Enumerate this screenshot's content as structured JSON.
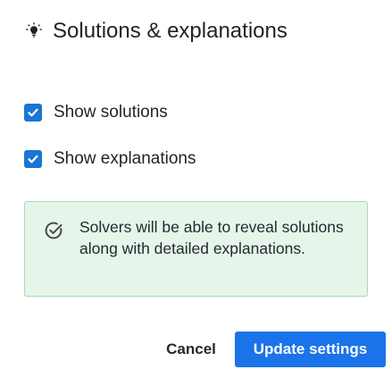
{
  "dialog": {
    "title": "Solutions & explanations",
    "title_icon": "lightbulb-icon"
  },
  "options": [
    {
      "label": "Show solutions",
      "checked": true
    },
    {
      "label": "Show explanations",
      "checked": true
    }
  ],
  "info": {
    "icon": "check-circle-icon",
    "text": "Solvers will be able to reveal solutions along with detailed explanations."
  },
  "actions": {
    "cancel_label": "Cancel",
    "update_label": "Update settings"
  },
  "colors": {
    "checkbox": "#1976d2",
    "primary_button": "#1a73e8",
    "info_background": "#e6f5ea",
    "info_border": "#a9dcb5",
    "info_icon": "#4a4a4a",
    "text": "#1f2328"
  }
}
